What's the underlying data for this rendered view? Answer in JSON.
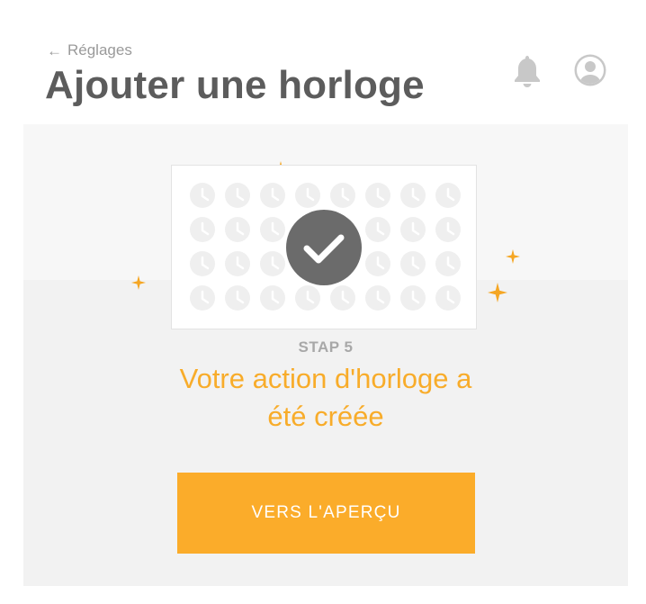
{
  "header": {
    "back_icon": "arrow-left-icon",
    "back_label": "Réglages",
    "title": "Ajouter une horloge",
    "bell_icon": "bell-icon",
    "avatar_icon": "user-avatar-icon"
  },
  "illustration": {
    "clock_icon": "clock-icon",
    "check_icon": "checkmark-icon",
    "sparkle_icon": "sparkle-icon"
  },
  "step": {
    "label": "STAP 5",
    "title_line1": "Votre action d'horloge a",
    "title_line2": "été créée"
  },
  "cta": {
    "label": "VERS L'APERÇU"
  },
  "colors": {
    "accent": "#fbac2a",
    "title_text": "#5c5c5c",
    "muted_text": "#9a9a9a",
    "icon_gray": "#c8c8c8",
    "check_circle": "#6b6b6b",
    "panel_bg": "#f2f2f2"
  }
}
